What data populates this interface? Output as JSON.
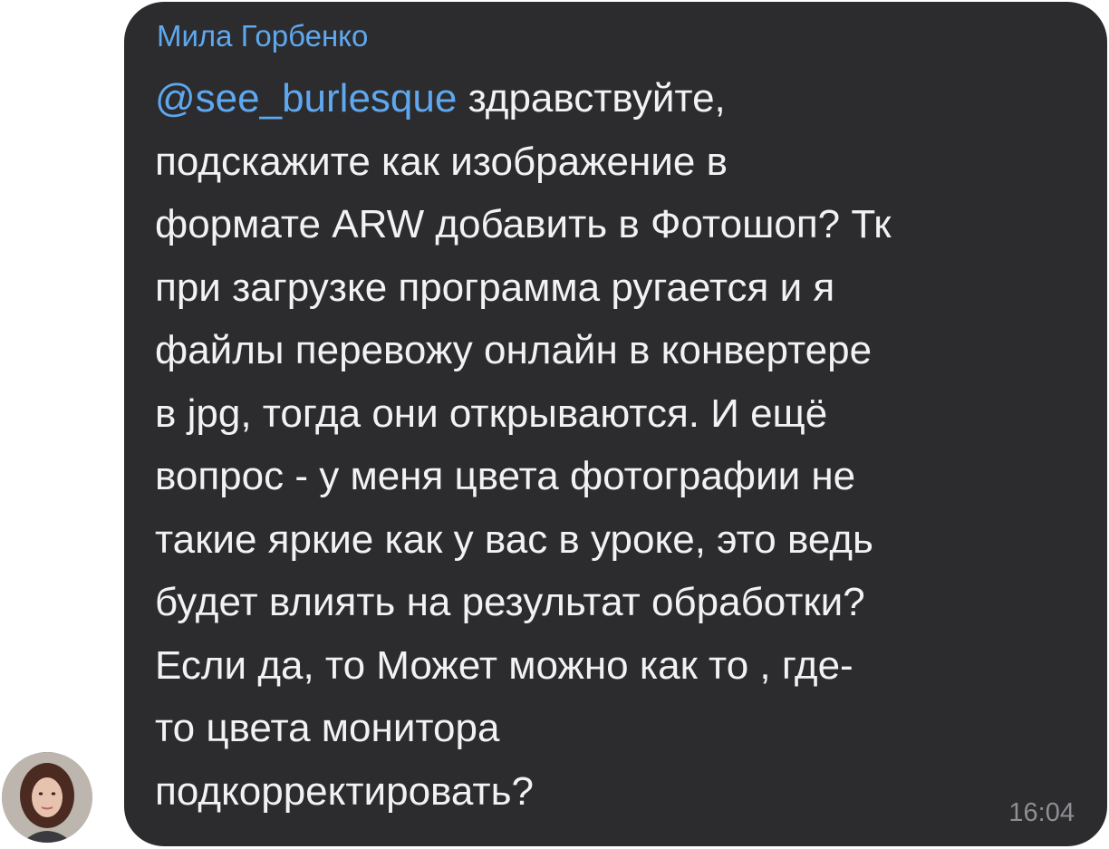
{
  "message": {
    "sender_name": "Мила Горбенко",
    "mention": "@see_burlesque",
    "lines": [
      " здравствуйте,",
      "подскажите как изображение в",
      "формате ARW добавить в Фотошоп? Тк",
      "при загрузке программа ругается и я",
      "файлы перевожу онлайн в конвертере",
      "в jpg, тогда они открываются. И ещё",
      "вопрос - у меня цвета фотографии не",
      "такие яркие как у вас в уроке, это ведь",
      "будет влиять на результат обработки?",
      "Если да, то Может можно как то , где-",
      "то цвета монитора",
      "подкорректировать?"
    ],
    "timestamp": "16:04"
  },
  "colors": {
    "bubble_background": "#2c2c2e",
    "accent": "#5ea8f0",
    "text": "#f2f2f4",
    "timestamp": "#8e8e93"
  }
}
